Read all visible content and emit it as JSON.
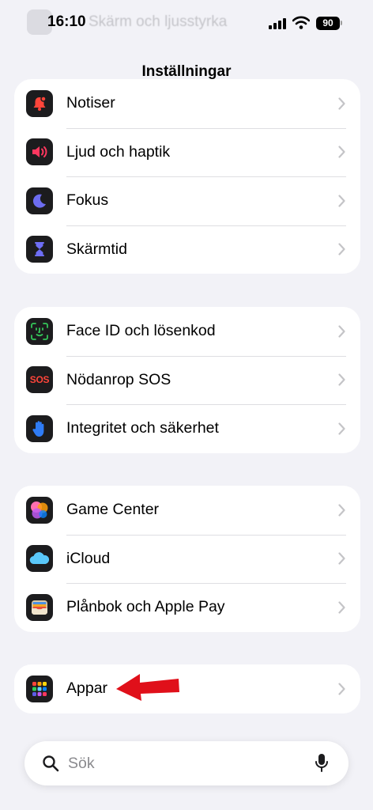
{
  "status_bar": {
    "time": "16:10",
    "battery": "90",
    "ghost_title": "Skärm och ljusstyrka"
  },
  "nav": {
    "title": "Inställningar"
  },
  "groups": [
    {
      "items": [
        {
          "label": "Notiser",
          "icon": "bell-badge-icon"
        },
        {
          "label": "Ljud och haptik",
          "icon": "speaker-icon"
        },
        {
          "label": "Fokus",
          "icon": "moon-icon"
        },
        {
          "label": "Skärmtid",
          "icon": "hourglass-icon"
        }
      ]
    },
    {
      "items": [
        {
          "label": "Face ID och lösenkod",
          "icon": "face-id-icon"
        },
        {
          "label": "Nödanrop SOS",
          "icon": "sos-icon",
          "icon_text": "SOS"
        },
        {
          "label": "Integritet och säkerhet",
          "icon": "hand-icon"
        }
      ]
    },
    {
      "items": [
        {
          "label": "Game Center",
          "icon": "game-center-icon"
        },
        {
          "label": "iCloud",
          "icon": "cloud-icon"
        },
        {
          "label": "Plånbok och Apple Pay",
          "icon": "wallet-icon"
        }
      ]
    },
    {
      "items": [
        {
          "label": "Appar",
          "icon": "apps-grid-icon"
        }
      ]
    }
  ],
  "search": {
    "placeholder": "Sök"
  },
  "colors": {
    "background": "#f2f2f7",
    "accent_arrow": "#e0101a",
    "sos_red": "#ff453a"
  }
}
